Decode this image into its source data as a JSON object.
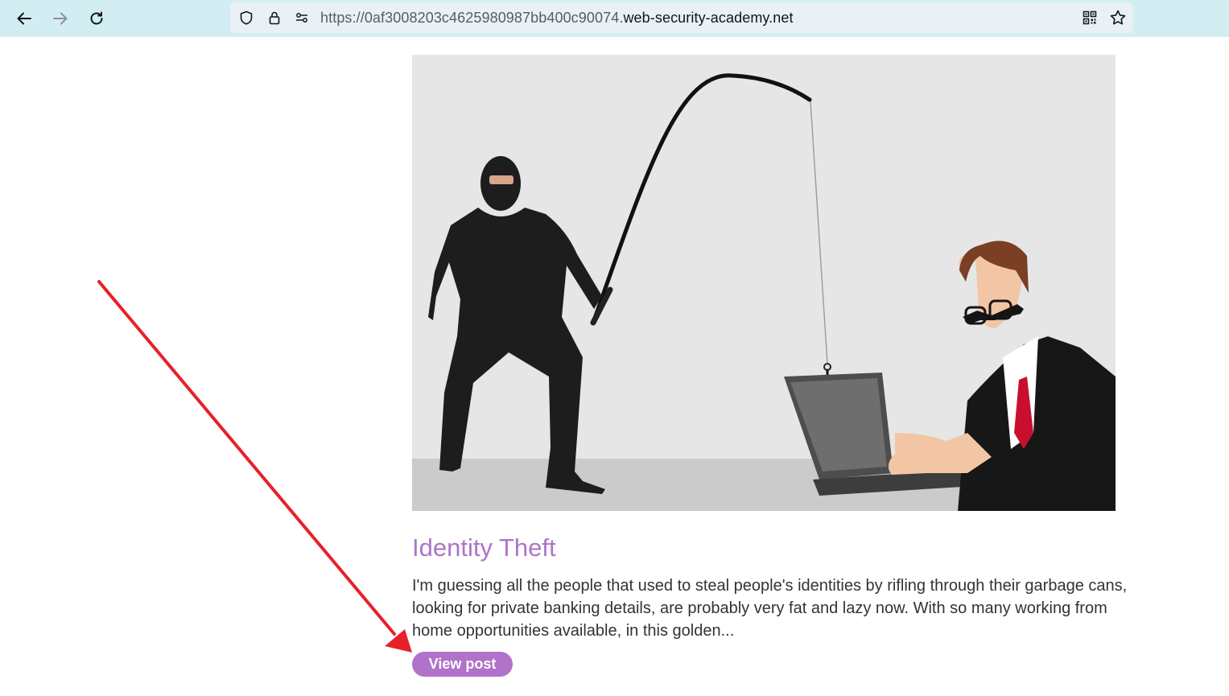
{
  "browser": {
    "url_prefix": "https://0af3008203c4625980987bb400c90074.",
    "url_domain": "web-security-academy.net",
    "icons": [
      "back-icon",
      "forward-icon",
      "reload-icon",
      "shield-icon",
      "lock-icon",
      "permissions-icon",
      "qr-code-icon",
      "bookmark-star-icon"
    ]
  },
  "post": {
    "title": "Identity Theft",
    "excerpt": "I'm guessing all the people that used to steal people's identities by rifling through their garbage cans, looking for private banking details, are probably very fat and lazy now. With so many working from home opportunities available, in this golden...",
    "button_label": "View post",
    "image": "phishing-illustration"
  },
  "colors": {
    "toolbar_bg": "#d3eef3",
    "title": "#ae75c5",
    "button_bg": "#b073c9",
    "arrow": "#e8202a"
  }
}
